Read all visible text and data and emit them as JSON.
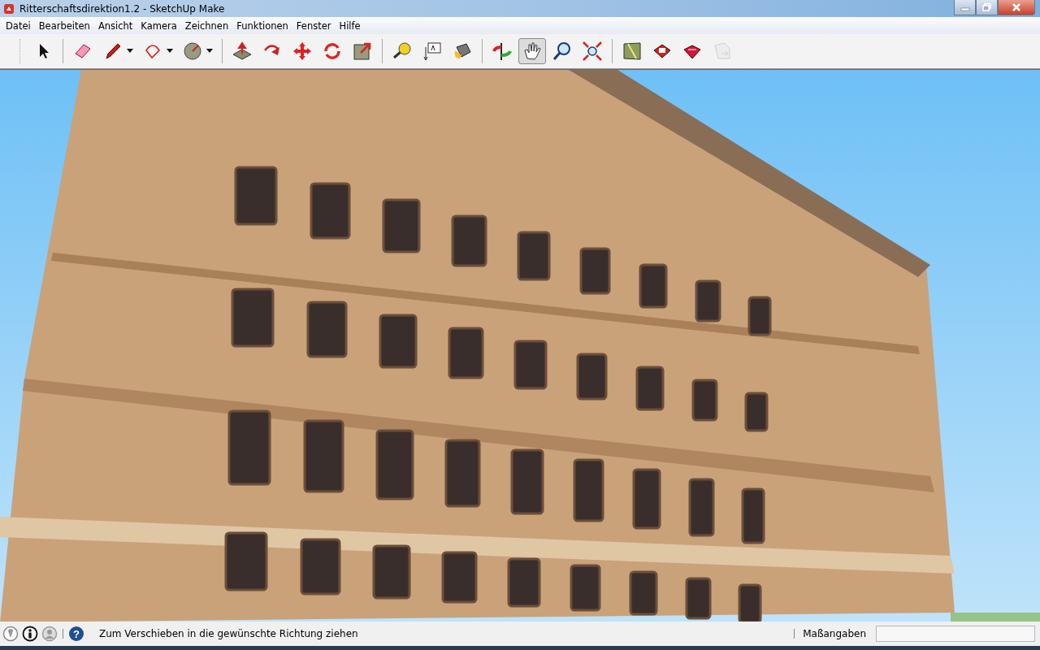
{
  "window": {
    "title": "Ritterschaftsdirektion1.2 - SketchUp Make"
  },
  "menu": [
    "Datei",
    "Bearbeiten",
    "Ansicht",
    "Kamera",
    "Zeichnen",
    "Funktionen",
    "Fenster",
    "Hilfe"
  ],
  "toolbar": {
    "groups": [
      {
        "tools": [
          {
            "selected": false,
            "dropdown": false
          }
        ]
      },
      {
        "tools": [
          {
            "selected": false,
            "dropdown": false
          },
          {
            "selected": false,
            "dropdown": true
          },
          {
            "selected": false,
            "dropdown": true
          },
          {
            "selected": false,
            "dropdown": true
          }
        ]
      },
      {
        "tools": [
          {
            "selected": false,
            "dropdown": false
          },
          {
            "selected": false,
            "dropdown": false
          },
          {
            "selected": false,
            "dropdown": false
          },
          {
            "selected": false,
            "dropdown": false
          },
          {
            "selected": false,
            "dropdown": false
          }
        ]
      },
      {
        "tools": [
          {
            "selected": false,
            "dropdown": false
          },
          {
            "selected": false,
            "dropdown": false
          },
          {
            "selected": false,
            "dropdown": false
          }
        ]
      },
      {
        "tools": [
          {
            "selected": false,
            "dropdown": false
          },
          {
            "selected": true,
            "dropdown": false
          },
          {
            "selected": false,
            "dropdown": false
          },
          {
            "selected": false,
            "dropdown": false
          }
        ]
      },
      {
        "tools": [
          {
            "selected": false,
            "dropdown": false
          },
          {
            "selected": false,
            "dropdown": false
          },
          {
            "selected": false,
            "dropdown": false
          },
          {
            "selected": false,
            "dropdown": false,
            "disabled": true
          }
        ]
      }
    ]
  },
  "status_bar": {
    "help_glyph": "?",
    "hint": "Zum Verschieben in die gewünschte Richtung ziehen",
    "measurements_label": "Maßangaben"
  }
}
